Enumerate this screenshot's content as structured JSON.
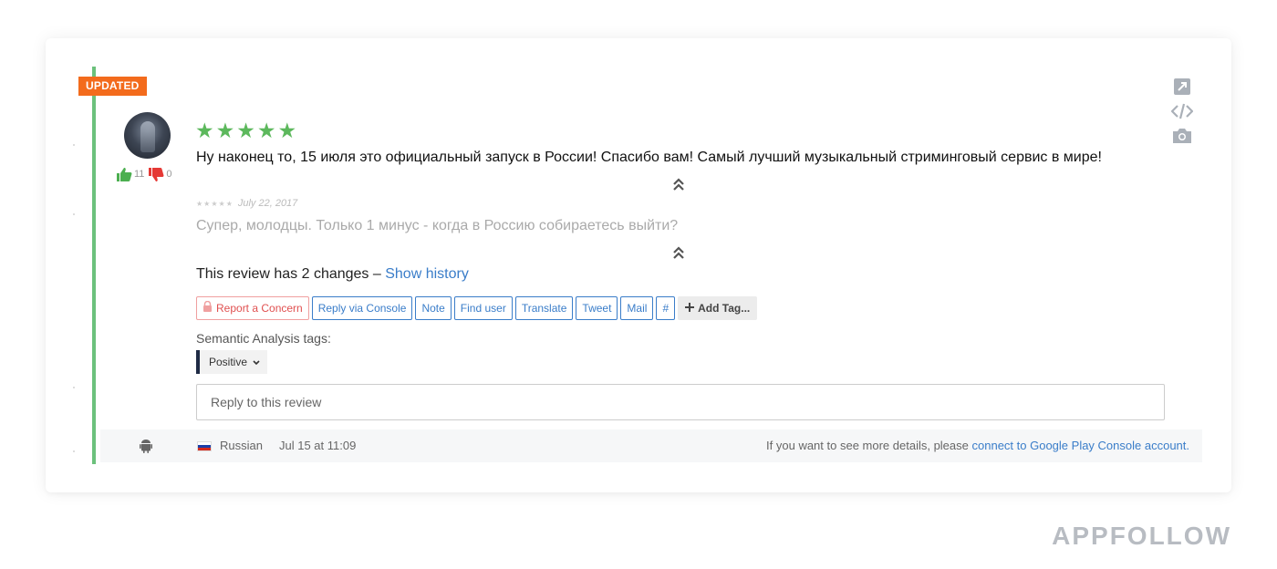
{
  "badge": "UPDATED",
  "votes": {
    "up": "11",
    "down": "0"
  },
  "review": {
    "rating": 5,
    "text": "Ну наконец то, 15 июля это официальный запуск в России! Спасибо вам! Самый лучший музыкальный стриминговый сервис в мире!"
  },
  "previous": {
    "date": "July 22, 2017",
    "text": "Супер, молодцы. Только 1 минус - когда в Россию собираетесь выйти?"
  },
  "history": {
    "prefix": "This review has 2 changes –",
    "link": "Show history"
  },
  "actions": {
    "report": "Report a Concern",
    "reply_console": "Reply via Console",
    "note": "Note",
    "find_user": "Find user",
    "translate": "Translate",
    "tweet": "Tweet",
    "mail": "Mail",
    "hash": "#",
    "add_tag": "Add Tag..."
  },
  "semantic": {
    "label": "Semantic Analysis tags:",
    "tag": "Positive"
  },
  "reply": {
    "placeholder": "Reply to this review"
  },
  "footer": {
    "platform_icon": "android-icon",
    "flag": "russia-flag",
    "language": "Russian",
    "date": "Jul 15 at 11:09",
    "info_prefix": "If you want to see more details, please",
    "info_link": "connect to Google Play Console account."
  },
  "side_icons": [
    "external-link-icon",
    "code-icon",
    "camera-icon"
  ],
  "brand": "APPFOLLOW",
  "colors": {
    "accent": "#3a7dc9",
    "star": "#5cb85c",
    "badge": "#f36b1c",
    "updated_bar": "#6cc17c",
    "thumb_up": "#4caf50",
    "thumb_down": "#e53935"
  }
}
